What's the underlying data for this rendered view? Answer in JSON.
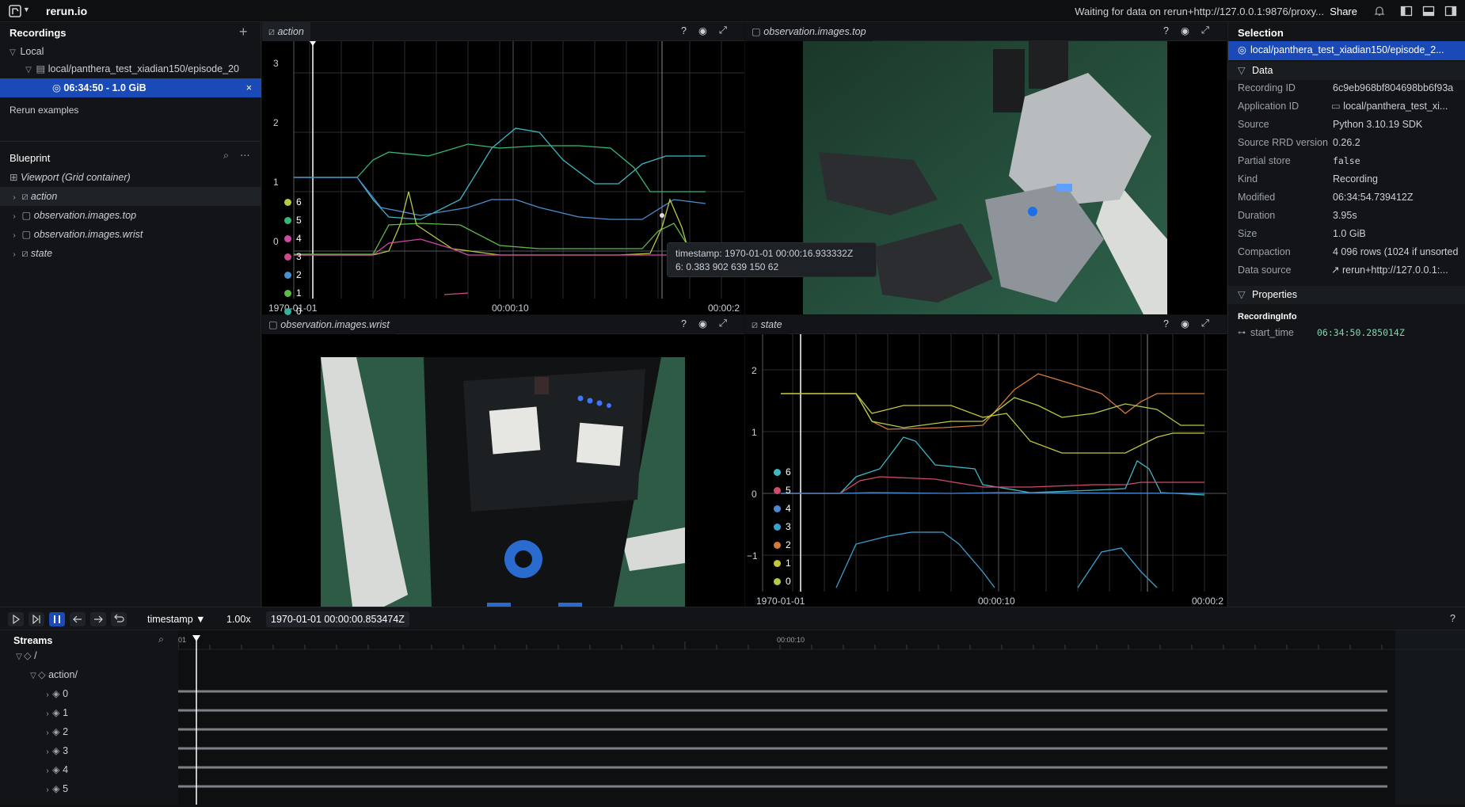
{
  "app": {
    "name": "rerun.io",
    "status": "Waiting for data on rerun+http://127.0.0.1:9876/proxy...",
    "share_label": "Share"
  },
  "recordings": {
    "title": "Recordings",
    "local_label": "Local",
    "app_path": "local/panthera_test_xiadian150/episode_20",
    "recording_label": "06:34:50 - 1.0 GiB",
    "examples_label": "Rerun examples"
  },
  "blueprint": {
    "title": "Blueprint",
    "viewport": "Viewport (Grid container)",
    "items": [
      "action",
      "observation.images.top",
      "observation.images.wrist",
      "state"
    ]
  },
  "views": {
    "action": {
      "title": "action",
      "yticks": [
        "3",
        "2",
        "1",
        "0"
      ],
      "xticks": [
        "1970-01-01",
        "00:00:10",
        "00:00:2"
      ],
      "legend": [
        "6",
        "5",
        "4",
        "3",
        "2",
        "1",
        "0"
      ]
    },
    "top": {
      "title": "observation.images.top"
    },
    "wrist": {
      "title": "observation.images.wrist"
    },
    "state": {
      "title": "state",
      "yticks": [
        "2",
        "1",
        "0",
        "−1"
      ],
      "xticks": [
        "1970-01-01",
        "00:00:10",
        "00:00:2"
      ],
      "legend": [
        "6",
        "5",
        "4",
        "3",
        "2",
        "1",
        "0"
      ]
    }
  },
  "tooltip": {
    "line1": "timestamp: 1970-01-01 00:00:16.933332Z",
    "line2": "6: 0.383 902 639 150 62"
  },
  "colors": {
    "c6": "#3fb8c4",
    "c5": "#37b776",
    "c4": "#d149a6",
    "c3": "#cf4a8d",
    "c2": "#4b8fcf",
    "c1": "#5dbb46",
    "c0": "#35b39b",
    "s6": "#3fb8c4",
    "s5": "#d24a6d",
    "s4": "#4a88cf",
    "s3": "#3e9fcf",
    "s2": "#d27a3a",
    "s1": "#c3c83b",
    "s0": "#b7c845"
  },
  "selection": {
    "title": "Selection",
    "item": "local/panthera_test_xiadian150/episode_2...",
    "data_title": "Data",
    "fields": [
      {
        "k": "Recording ID",
        "v": "6c9eb968bf804698bb6f93a"
      },
      {
        "k": "Application ID",
        "v": "local/panthera_test_xi..."
      },
      {
        "k": "Source",
        "v": "Python 3.10.19 SDK"
      },
      {
        "k": "Source RRD version",
        "v": "0.26.2"
      },
      {
        "k": "Partial store",
        "v": "false"
      },
      {
        "k": "Kind",
        "v": "Recording"
      },
      {
        "k": "Modified",
        "v": "06:34:54.739412Z"
      },
      {
        "k": "Duration",
        "v": "3.95s"
      },
      {
        "k": "Size",
        "v": "1.0 GiB"
      },
      {
        "k": "Compaction",
        "v": "4 096 rows (1024 if unsorted"
      },
      {
        "k": "Data source",
        "v": "rerun+http://127.0.0.1:..."
      }
    ],
    "properties_title": "Properties",
    "recording_info": "RecordingInfo",
    "start_time_key": "start_time",
    "start_time_val": "06:34:50.285014Z"
  },
  "timebar": {
    "timeline": "timestamp",
    "speed": "1.00x",
    "time": "1970-01-01 00:00:00.853474Z"
  },
  "streams": {
    "title": "Streams",
    "root": "/",
    "group": "action/",
    "items": [
      "0",
      "1",
      "2",
      "3",
      "4",
      "5"
    ],
    "ruler_left": "01",
    "ruler_mid": "00:00:10"
  }
}
